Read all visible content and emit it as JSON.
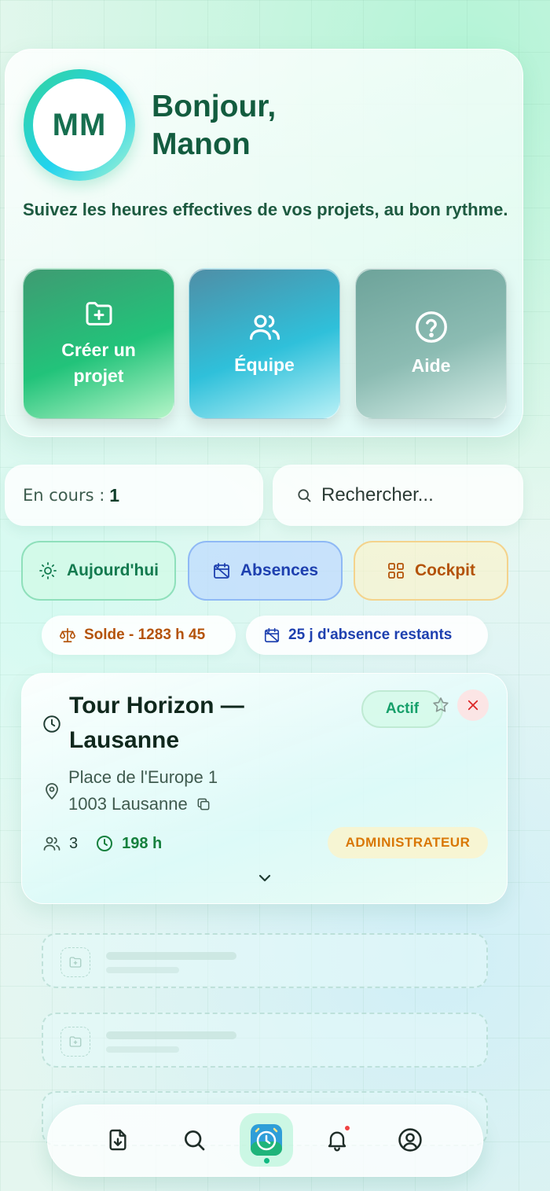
{
  "user": {
    "initials": "MM",
    "greeting_line1": "Bonjour,",
    "greeting_line2": "Manon"
  },
  "tagline": "Suivez les heures effectives de vos projets, au bon rythme.",
  "quick_actions": [
    {
      "line1": "Créer un",
      "line2": "projet",
      "icon": "folder-plus-icon"
    },
    {
      "label": "Équipe",
      "icon": "users-icon"
    },
    {
      "label": "Aide",
      "icon": "help-circle-icon"
    }
  ],
  "status": {
    "label": "En cours :",
    "count": "1"
  },
  "search": {
    "placeholder": "Rechercher..."
  },
  "filters": [
    {
      "label": "Aujourd'hui",
      "icon": "sun-icon"
    },
    {
      "label": "Absences",
      "icon": "calendar-off-icon"
    },
    {
      "label": "Cockpit",
      "icon": "grid-icon"
    }
  ],
  "summary": {
    "solde": "Solde - 1283 h 45",
    "absence_left": "25 j d'absence restants"
  },
  "project": {
    "title_line1": "Tour Horizon —",
    "title_line2": "Lausanne",
    "status": "Actif",
    "address_line1": "Place de l'Europe 1",
    "address_line2": "1003 Lausanne",
    "members": "3",
    "hours": "198 h",
    "role": "ADMINISTRATEUR"
  },
  "nav": [
    "download-icon",
    "search-icon",
    "timer-icon",
    "bell-icon",
    "user-circle-icon"
  ],
  "colors": {
    "primary_green": "#22c37a",
    "accent_blue": "#1e40af",
    "accent_orange": "#b45309",
    "danger": "#dc2626"
  }
}
